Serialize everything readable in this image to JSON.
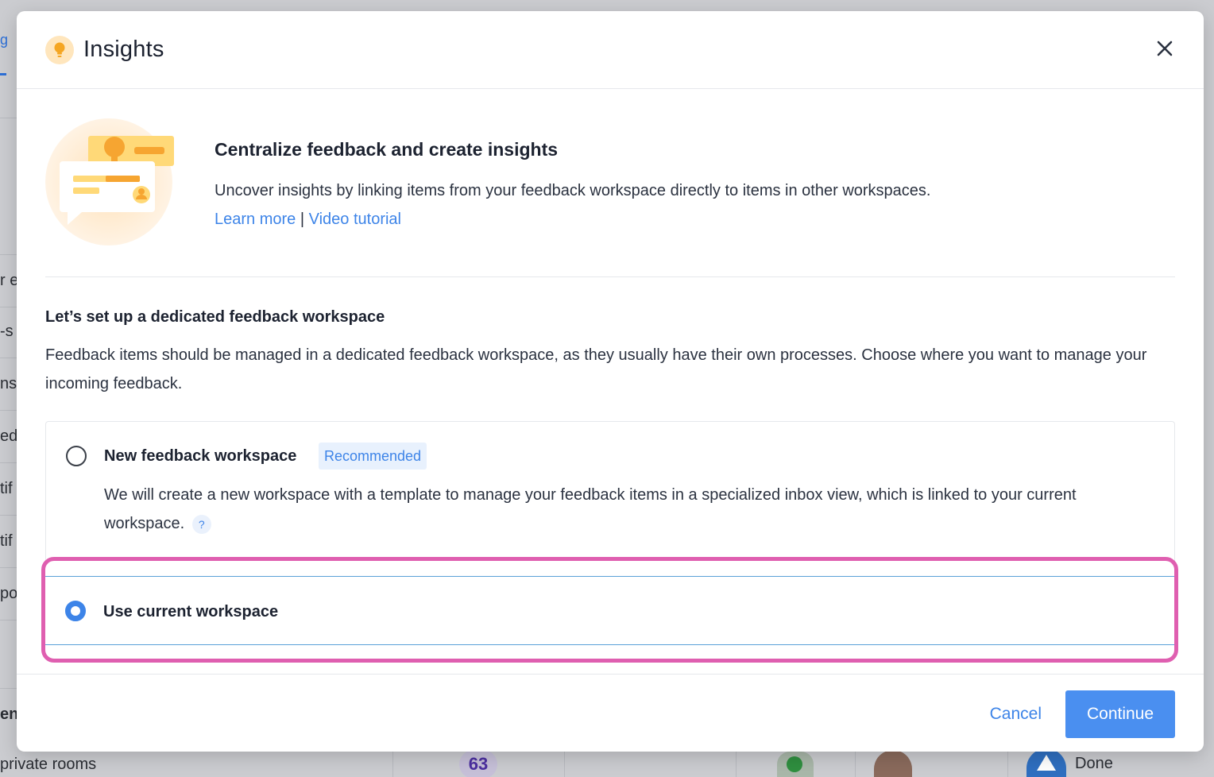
{
  "background": {
    "tab_label": "g",
    "left_cells": [
      "r e",
      "-s",
      "ns",
      "ed",
      "tif",
      "tif",
      "poi",
      "ent"
    ],
    "bottom_row": {
      "name": "private rooms",
      "count": "63",
      "status": "Done"
    }
  },
  "dialog": {
    "title": "Insights",
    "header_icon": "lightbulb-icon",
    "close_icon": "close-icon",
    "hero": {
      "title": "Centralize feedback and create insights",
      "description": "Uncover insights by linking items from your feedback workspace directly to items in other workspaces.",
      "link_learn_more": "Learn more",
      "link_separator": "|",
      "link_video": "Video tutorial"
    },
    "setup": {
      "title": "Let’s set up a dedicated feedback workspace",
      "description": "Feedback items should be managed in a dedicated feedback workspace, as they usually have their own processes. Choose where you want to manage your incoming feedback."
    },
    "options": [
      {
        "label": "New feedback workspace",
        "badge": "Recommended",
        "description": "We will create a new workspace with a template to manage your feedback items in a specialized inbox view, which is linked to your current workspace.",
        "help": "?",
        "selected": false
      },
      {
        "label": "Use current workspace",
        "selected": true
      }
    ],
    "footer": {
      "cancel_label": "Cancel",
      "continue_label": "Continue"
    }
  },
  "colors": {
    "accent": "#3d84e8",
    "highlight": "#df5fb0",
    "primary_button": "#4a8ff0"
  }
}
